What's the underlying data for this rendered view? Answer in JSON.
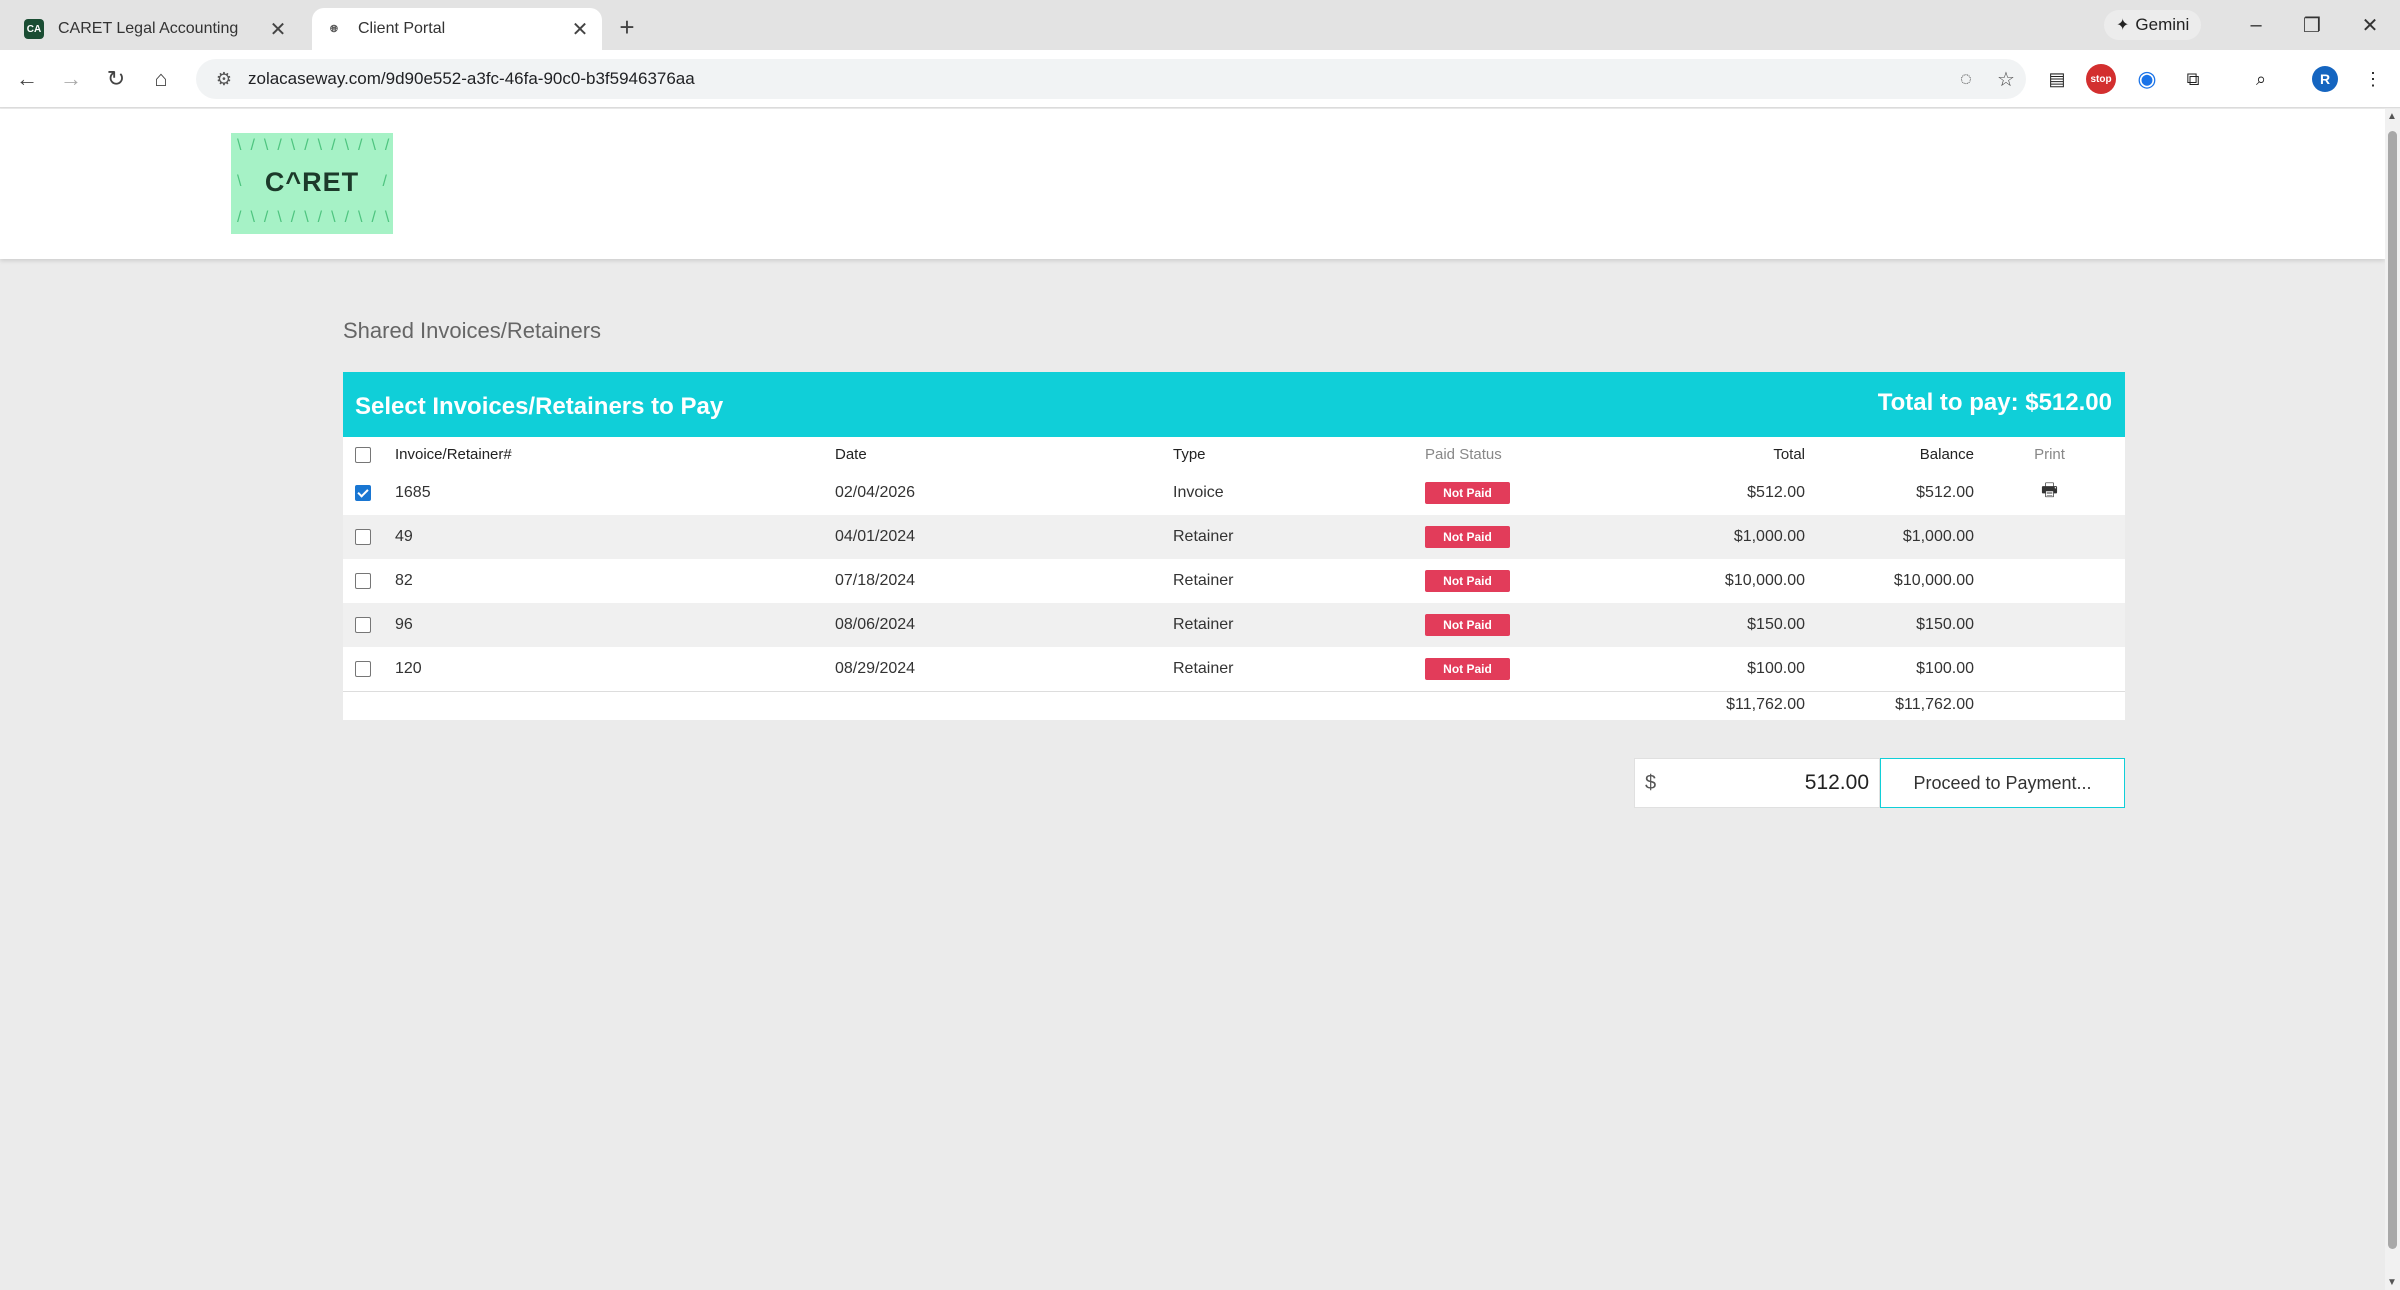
{
  "browser": {
    "tabs": [
      {
        "favicon": "CA",
        "title": "CARET Legal Accounting",
        "active": false
      },
      {
        "favicon": "globe-icon",
        "title": "Client Portal",
        "active": true
      }
    ],
    "gemini_label": "Gemini",
    "url": "zolacaseway.com/9d90e552-a3fc-46fa-90c0-b3f5946376aa",
    "stop_ext_label": "stop",
    "profile_initial": "R"
  },
  "header": {
    "logo_text": "C^RET"
  },
  "page": {
    "section_title": "Shared Invoices/Retainers",
    "panel_title": "Select Invoices/Retainers to Pay",
    "total_to_pay": "Total to pay: $512.00",
    "columns": {
      "number": "Invoice/Retainer#",
      "date": "Date",
      "type": "Type",
      "status": "Paid Status",
      "total": "Total",
      "balance": "Balance",
      "print": "Print"
    },
    "rows": [
      {
        "checked": true,
        "number": "1685",
        "date": "02/04/2026",
        "type": "Invoice",
        "status": "Not Paid",
        "total": "$512.00",
        "balance": "$512.00",
        "printable": true
      },
      {
        "checked": false,
        "number": "49",
        "date": "04/01/2024",
        "type": "Retainer",
        "status": "Not Paid",
        "total": "$1,000.00",
        "balance": "$1,000.00",
        "printable": false
      },
      {
        "checked": false,
        "number": "82",
        "date": "07/18/2024",
        "type": "Retainer",
        "status": "Not Paid",
        "total": "$10,000.00",
        "balance": "$10,000.00",
        "printable": false
      },
      {
        "checked": false,
        "number": "96",
        "date": "08/06/2024",
        "type": "Retainer",
        "status": "Not Paid",
        "total": "$150.00",
        "balance": "$150.00",
        "printable": false
      },
      {
        "checked": false,
        "number": "120",
        "date": "08/29/2024",
        "type": "Retainer",
        "status": "Not Paid",
        "total": "$100.00",
        "balance": "$100.00",
        "printable": false
      }
    ],
    "grand_total": "$11,762.00",
    "grand_balance": "$11,762.00",
    "currency_symbol": "$",
    "payment_amount": "512.00",
    "proceed_label": "Proceed to Payment..."
  },
  "colors": {
    "accent": "#10cfd8",
    "badge_red": "#e23c5a",
    "logo_bg": "#a6f2c6"
  }
}
